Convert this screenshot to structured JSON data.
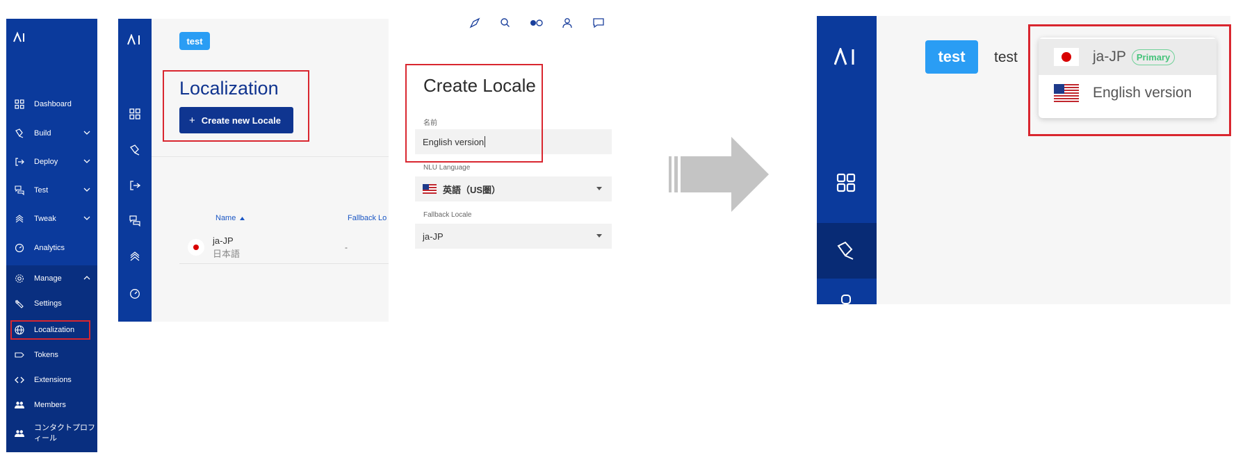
{
  "colors": {
    "sidebar_bg": "#0b3a9c",
    "sidebar_active_bg": "#092f80",
    "primary_button": "#0f3590",
    "badge_blue": "#2a9df4",
    "highlight_red": "#d9262f",
    "primary_badge_green": "#45c37a"
  },
  "sidebar": {
    "logo_icon": "ai-logo",
    "items": [
      {
        "label": "Dashboard",
        "icon": "grid-icon"
      },
      {
        "label": "Build",
        "icon": "pen-tool-icon",
        "expandable": true
      },
      {
        "label": "Deploy",
        "icon": "deploy-arrow-icon",
        "expandable": true
      },
      {
        "label": "Test",
        "icon": "chat-bubbles-icon",
        "expandable": true
      },
      {
        "label": "Tweak",
        "icon": "layers-icon",
        "expandable": true
      },
      {
        "label": "Analytics",
        "icon": "gauge-icon"
      },
      {
        "label": "Manage",
        "icon": "gear-icon",
        "expanded": true
      },
      {
        "label": "Settings",
        "icon": "wrench-icon"
      },
      {
        "label": "Localization",
        "icon": "globe-icon"
      },
      {
        "label": "Tokens",
        "icon": "tag-icon"
      },
      {
        "label": "Extensions",
        "icon": "code-icon"
      },
      {
        "label": "Members",
        "icon": "people-icon"
      },
      {
        "label": "コンタクトプロフィール",
        "icon": "people-icon"
      }
    ]
  },
  "localization_page": {
    "project_badge": "test",
    "title": "Localization",
    "create_button": "Create new Locale",
    "table": {
      "columns": [
        "Name",
        "Fallback Lo"
      ],
      "rows": [
        {
          "name": "ja-JP",
          "sub": "日本語",
          "fallback": "-"
        }
      ]
    }
  },
  "create_locale": {
    "title": "Create Locale",
    "name_label": "名前",
    "name_value": "English version",
    "nlu_label": "NLU Language",
    "nlu_value": "英語（US圏）",
    "fallback_label": "Fallback Locale",
    "fallback_value": "ja-JP",
    "toolbar_icons": [
      "compass-icon",
      "search-icon",
      "toggle-icon",
      "user-icon",
      "message-icon"
    ]
  },
  "zoom_panel": {
    "project_badge": "test",
    "project_name": "test",
    "dropdown": [
      {
        "label": "ja-JP",
        "badge": "Primary",
        "flag": "jp-flag-icon"
      },
      {
        "label": "English version",
        "flag": "us-flag-icon"
      }
    ]
  }
}
